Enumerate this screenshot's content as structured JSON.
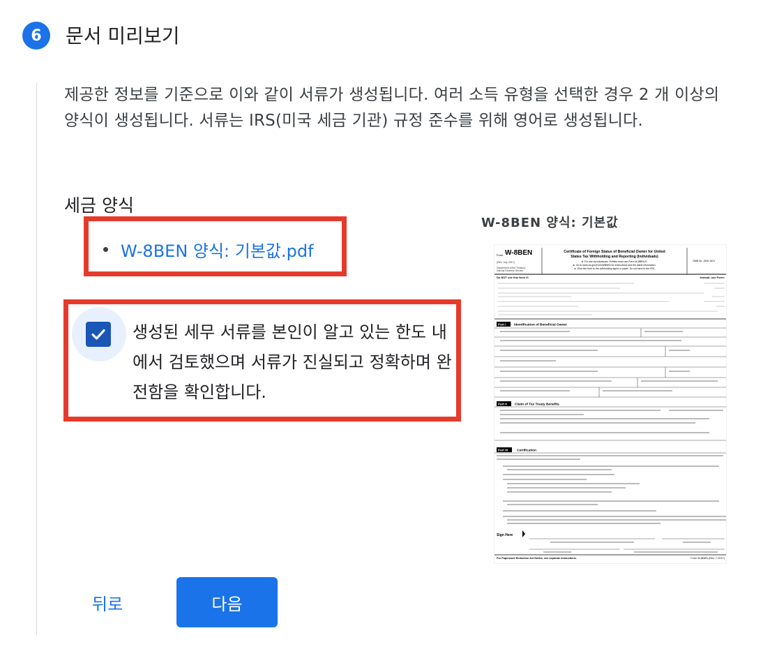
{
  "step": {
    "number": "6",
    "title": "문서 미리보기"
  },
  "description": "제공한 정보를 기준으로 이와 같이 서류가 생성됩니다. 여러 소득 유형을 선택한 경우 2 개 이상의 양식이 생성됩니다. 서류는 IRS(미국 세금 기관) 규정 준수를 위해 영어로 생성됩니다.",
  "forms": {
    "label": "세금 양식",
    "items": [
      {
        "name": "W-8BEN 양식: 기본값.pdf"
      }
    ]
  },
  "confirmation": {
    "checked": true,
    "text": "생성된 세무 서류를 본인이 알고 있는 한도 내에서 검토했으며 서류가 진실되고 정확하며 완전함을 확인합니다."
  },
  "preview": {
    "caption": "W-8BEN 양식: 기본값",
    "form": {
      "form_prefix": "Form",
      "form_id": "W-8BEN",
      "rev": "(Rev. July 2017)",
      "dept": "Department of the Treasury",
      "irs": "Internal Revenue Service",
      "title_line1": "Certificate of Foreign Status of Beneficial Owner for United",
      "title_line2": "States Tax Withholding and Reporting (Individuals)",
      "bullet1": "► For use by individuals. Entities must use Form W-8BEN-E.",
      "bullet2": "► Go to www.irs.gov/FormW8BEN for instructions and the latest information.",
      "bullet3": "► Give this form to the withholding agent or payer. Do not send to the IRS.",
      "omb": "OMB No. 1545-1621",
      "do_not_use": "Do NOT use this form if:",
      "instead": "Instead, use Form:",
      "part1": "Part I",
      "part1_title": "Identification of Beneficial Owner",
      "part2": "Part II",
      "part2_title": "Claim of Tax Treaty Benefits",
      "part3": "Part III",
      "part3_title": "Certification",
      "sign_here": "Sign Here",
      "footer_left": "For Paperwork Reduction Act Notice, see separate instructions.",
      "footer_form": "Form W-8BEN (Rev. 7-2017)"
    }
  },
  "buttons": {
    "back": "뒤로",
    "next": "다음"
  },
  "colors": {
    "accent": "#1a73e8",
    "highlight": "#e53b2c",
    "checkbox": "#1a56b5"
  }
}
